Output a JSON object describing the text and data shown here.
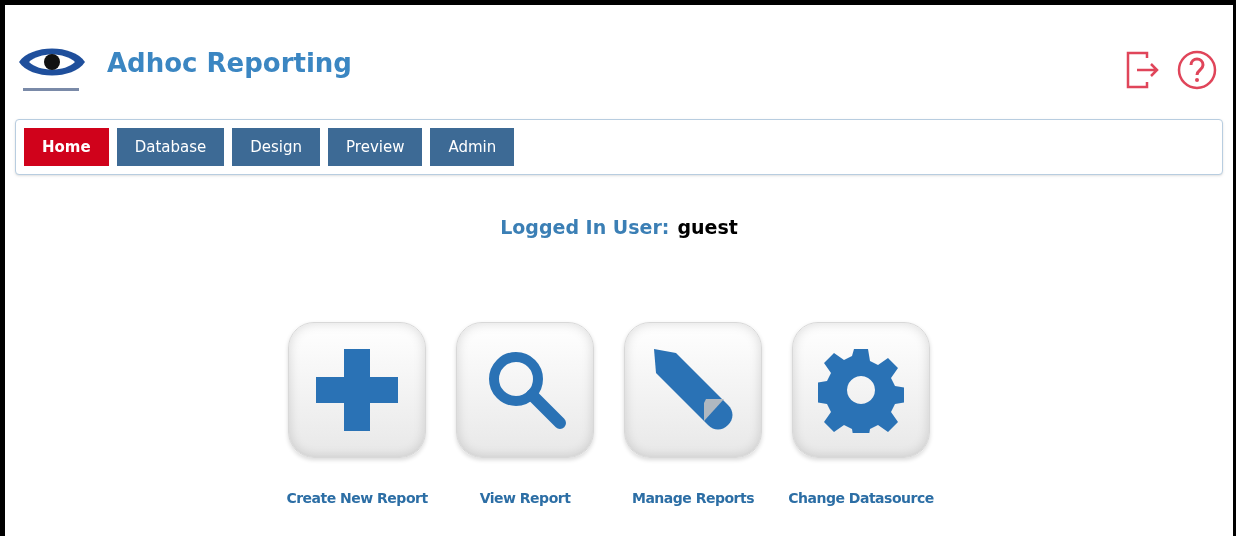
{
  "header": {
    "title": "Adhoc Reporting"
  },
  "tabs": [
    {
      "label": "Home",
      "selected": true
    },
    {
      "label": "Database",
      "selected": false
    },
    {
      "label": "Design",
      "selected": false
    },
    {
      "label": "Preview",
      "selected": false
    },
    {
      "label": "Admin",
      "selected": false
    }
  ],
  "user": {
    "label": "Logged In User:",
    "name": "guest"
  },
  "actions": [
    {
      "kind": "plus",
      "label": "Create New Report"
    },
    {
      "kind": "search",
      "label": "View Report"
    },
    {
      "kind": "pencil",
      "label": "Manage Reports"
    },
    {
      "kind": "gear",
      "label": "Change Datasource"
    }
  ]
}
